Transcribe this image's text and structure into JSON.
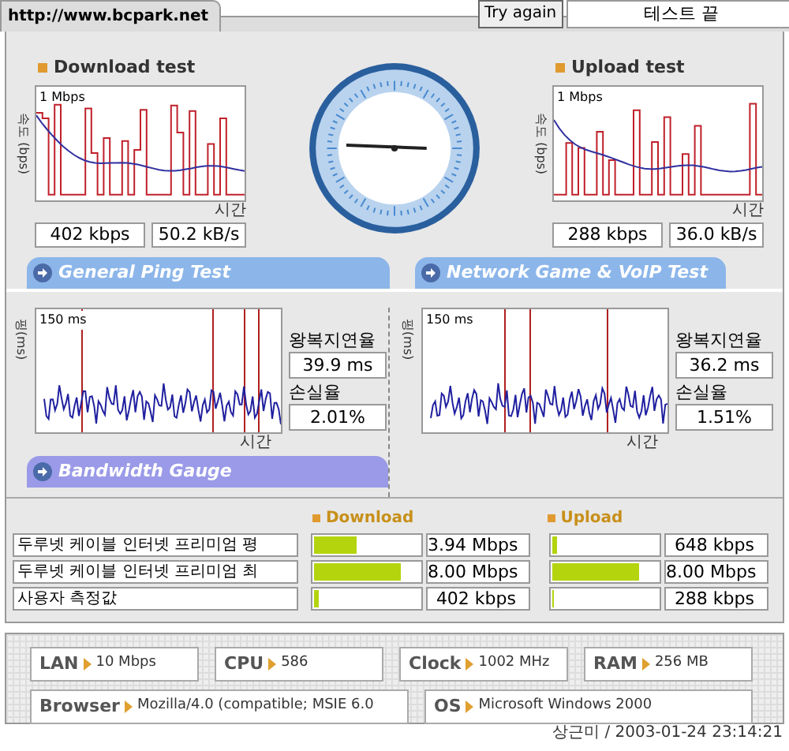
{
  "header": {
    "url": "http://www.bcpark.net",
    "try_again": "Try again",
    "status": "테스트 끝"
  },
  "download": {
    "title": "Download test",
    "y_axis": "속도 (bps)",
    "scale": "1 Mbps",
    "x_axis": "시간",
    "rate": "402 kbps",
    "bytes": "50.2 kB/s"
  },
  "upload": {
    "title": "Upload test",
    "y_axis": "속도 (bps)",
    "scale": "1 Mbps",
    "x_axis": "시간",
    "rate": "288 kbps",
    "bytes": "36.0 kB/s"
  },
  "ping_tabs": [
    {
      "label": "General Ping Test"
    },
    {
      "label": "Network Game & VoIP Test"
    }
  ],
  "ping_panels": [
    {
      "y_axis": "핑(ms)",
      "scale": "150 ms",
      "x_axis": "시간",
      "latency_label": "왕복지연율",
      "latency": "39.9 ms",
      "loss_label": "손실율",
      "loss": "2.01%"
    },
    {
      "y_axis": "핑(ms)",
      "scale": "150 ms",
      "x_axis": "시간",
      "latency_label": "왕복지연율",
      "latency": "36.2 ms",
      "loss_label": "손실율",
      "loss": "1.51%"
    }
  ],
  "bandwidth": {
    "title": "Bandwidth Gauge",
    "columns": [
      "Download",
      "Upload"
    ],
    "rows": [
      {
        "label": "두루넷 케이블 인터넷 프리미엄 평",
        "download": {
          "level": 0.4,
          "value": "3.94 Mbps"
        },
        "upload": {
          "level": 0.04,
          "value": "648 kbps"
        }
      },
      {
        "label": "두루넷 케이블 인터넷 프리미엄 최",
        "download": {
          "level": 0.82,
          "value": "8.00 Mbps"
        },
        "upload": {
          "level": 0.82,
          "value": "8.00 Mbps"
        }
      },
      {
        "label": "사용자 측정값",
        "download": {
          "level": 0.04,
          "value": "402 kbps"
        },
        "upload": {
          "level": 0.02,
          "value": "288 kbps"
        }
      }
    ]
  },
  "system": [
    {
      "label": "LAN",
      "value": "10 Mbps"
    },
    {
      "label": "CPU",
      "value": "586"
    },
    {
      "label": "Clock",
      "value": "1002 MHz"
    },
    {
      "label": "RAM",
      "value": "256 MB"
    },
    {
      "label": "Browser",
      "value": "Mozilla/4.0 (compatible; MSIE 6.0"
    },
    {
      "label": "OS",
      "value": "Microsoft Windows 2000"
    }
  ],
  "footer": "상근미 / 2003-01-24 23:14:21"
}
